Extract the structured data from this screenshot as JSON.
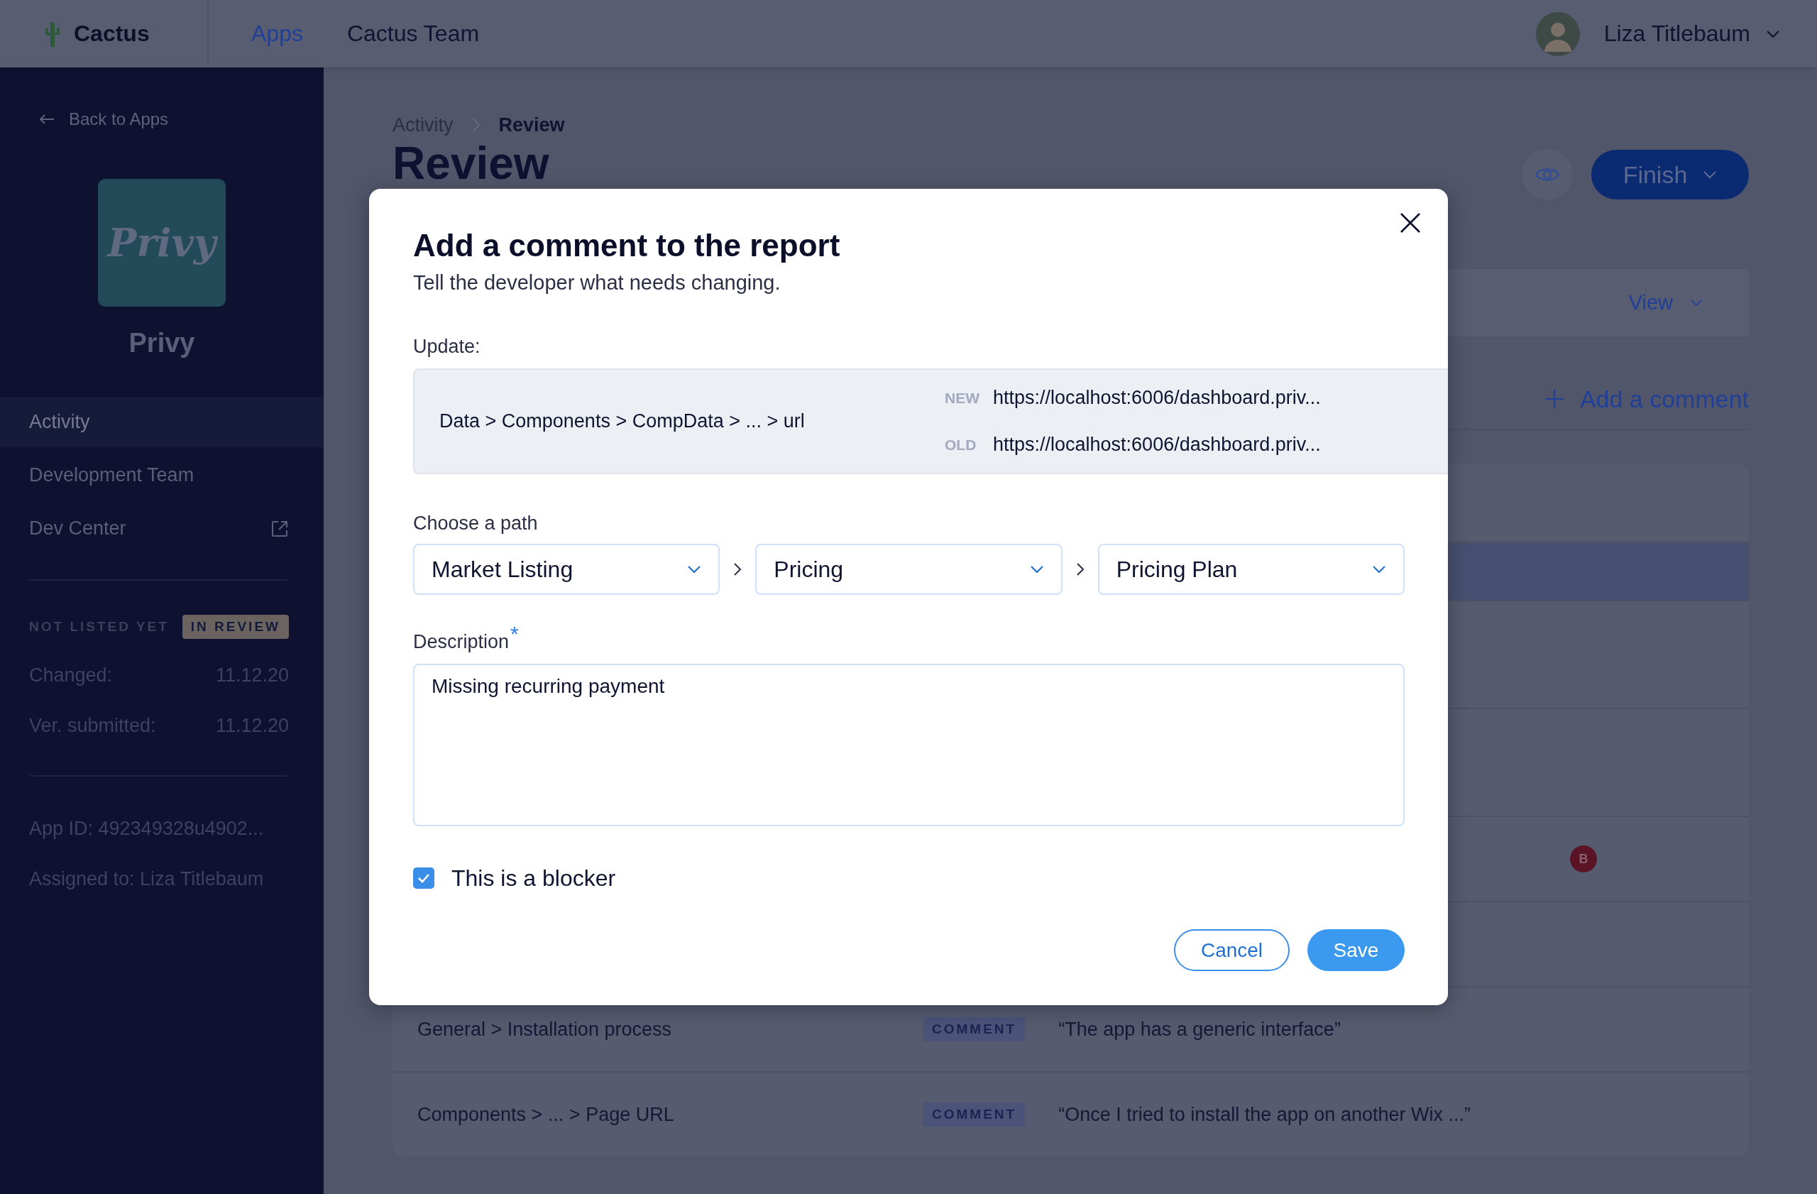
{
  "top_bar": {
    "brand": "Cactus",
    "nav": [
      {
        "label": "Apps",
        "selected": true
      },
      {
        "label": "Cactus Team",
        "selected": false
      }
    ],
    "user": "Liza Titlebaum"
  },
  "sidebar": {
    "back_link": "Back to Apps",
    "logo_text": "Privy",
    "app_name": "Privy",
    "items": [
      {
        "label": "Activity",
        "selected": true,
        "external": false
      },
      {
        "label": "Development Team",
        "selected": false,
        "external": false
      },
      {
        "label": "Dev Center",
        "selected": false,
        "external": true
      }
    ],
    "listing_status": "NOT LISTED YET",
    "review_badge": "IN REVIEW",
    "dates": [
      {
        "label": "Changed:",
        "value": "11.12.20"
      },
      {
        "label": "Ver. submitted:",
        "value": "11.12.20"
      }
    ],
    "app_id": "App ID: 492349328u4902...",
    "assigned": "Assigned to: Liza Titlebaum"
  },
  "page": {
    "breadcrumb": [
      {
        "label": "Activity",
        "selected": false
      },
      {
        "label": "Review",
        "selected": true
      }
    ],
    "title": "Review",
    "finish_button": "Finish",
    "view_dropdown": "View",
    "add_comment": "Add a comment",
    "table": {
      "rows": [
        {
          "selected": false
        },
        {
          "selected": true
        },
        {
          "selected": false
        },
        {
          "selected": false
        },
        {
          "selected": false,
          "badge": "B"
        },
        {
          "selected": false
        },
        {
          "selected": false,
          "path": "General > Installation process",
          "tag": "COMMENT",
          "comment": "“The app has a generic interface”"
        },
        {
          "selected": false,
          "path": "Components > ... > Page URL",
          "tag": "COMMENT",
          "comment": "“Once I tried to install the app on another Wix ...”"
        }
      ]
    }
  },
  "dialog": {
    "title": "Add a comment to the report",
    "subtitle": "Tell the developer what needs changing.",
    "update_label": "Update:",
    "update": {
      "path": "Data > Components > CompData > ... > url",
      "changes": [
        {
          "tag": "NEW",
          "value": "https://localhost:6006/dashboard.priv..."
        },
        {
          "tag": "OLD",
          "value": "https://localhost:6006/dashboard.priv..."
        }
      ]
    },
    "path_label": "Choose a path",
    "path_selects": [
      "Market Listing",
      "Pricing",
      "Pricing Plan"
    ],
    "description_label": "Description",
    "required_mark": "*",
    "description": "Missing recurring payment",
    "blocker": {
      "label": "This is a blocker",
      "checked": true
    },
    "buttons": [
      {
        "label": "Cancel",
        "kind": "secondary"
      },
      {
        "label": "Save",
        "kind": "primary"
      }
    ]
  }
}
